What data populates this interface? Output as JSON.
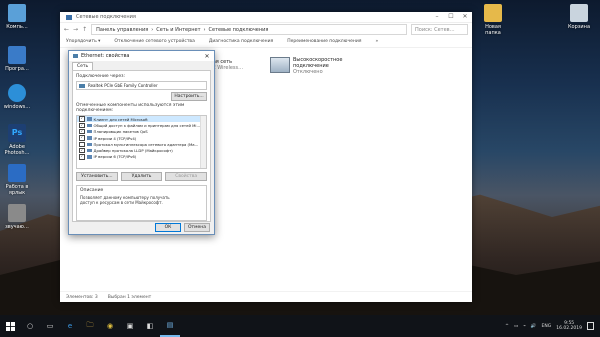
{
  "desktop": {
    "left_icons": [
      {
        "label": "Компь…",
        "color": "#5aa0d8"
      },
      {
        "label": "Програ…",
        "color": "#3a7bc8"
      },
      {
        "label": "windows…",
        "color": "#2c8fd8"
      },
      {
        "label": "Adobe Photosh…",
        "color": "#1d3f73"
      },
      {
        "label": "Работа в ярлык",
        "color": "#2b6cc4"
      },
      {
        "label": "звучаю…",
        "color": "#8a8a8a"
      }
    ],
    "right_icons": [
      {
        "label": "Новая папка",
        "color": "#e6b94a"
      },
      {
        "label": "Корзина",
        "color": "#c9d4de"
      }
    ]
  },
  "explorer": {
    "title": "Сетевые подключения",
    "controls": [
      "–",
      "☐",
      "✕"
    ],
    "nav": [
      "←",
      "→",
      "↑"
    ],
    "breadcrumb": [
      "Панель управления",
      "›",
      "Сеть и Интернет",
      "›",
      "Сетевые подключения"
    ],
    "search_placeholder": "Поиск: Сетев…",
    "commands": [
      "Упорядочить ▾",
      "Отключение сетевого устройства",
      "Диагностика подключения",
      "Переименование подключения",
      "»"
    ],
    "connections": [
      {
        "name": "…водная сеть",
        "sub": "…82TAE Wireless…"
      },
      {
        "name": "Высокоскоростное подключение",
        "sub": "Отключено"
      }
    ],
    "status": [
      "Элементов: 3",
      "Выбран 1 элемент"
    ]
  },
  "dialog": {
    "title": "Ethernet: свойства",
    "close": "✕",
    "tab": "Сеть",
    "connect_label": "Подключение через:",
    "adapter": "Realtek PCIe GbE Family Controller",
    "configure_button": "Настроить...",
    "components_label": "Отмеченные компоненты используются этим подключением:",
    "components": [
      {
        "checked": true,
        "label": "Клиент для сетей Microsoft",
        "selected": true
      },
      {
        "checked": true,
        "label": "Общий доступ к файлам и принтерам для сетей Mi…",
        "selected": false
      },
      {
        "checked": true,
        "label": "Планировщик пакетов QoS",
        "selected": false
      },
      {
        "checked": true,
        "label": "IP версии 4 (TCP/IPv4)",
        "selected": false
      },
      {
        "checked": false,
        "label": "Протокол мультиплексора сетевого адаптера (Ма…",
        "selected": false
      },
      {
        "checked": true,
        "label": "Драйвер протокола LLDP (Майкрософт)",
        "selected": false
      },
      {
        "checked": true,
        "label": "IP версии 6 (TCP/IPv6)",
        "selected": false
      }
    ],
    "install_button": "Установить...",
    "remove_button": "Удалить",
    "properties_button": "Свойства",
    "description_label": "Описание",
    "description": "Позволяет данному компьютеру получать доступ к ресурсам в сети Майкрософт.",
    "ok_button": "ОК",
    "cancel_button": "Отмена"
  },
  "taskbar": {
    "start_icon": "windows-logo",
    "items": [
      "○",
      "▭",
      "e",
      "🗀",
      "◉",
      "▣",
      "◧",
      "▤"
    ],
    "active_index": 7,
    "tray": [
      "^",
      "▭",
      "⌁",
      "🔊",
      "ENG"
    ],
    "time": "9:55",
    "date": "16.02.2019"
  },
  "colors": {
    "accent": "#0078d7",
    "selection": "#cde8ff",
    "taskbar": "#101318"
  }
}
